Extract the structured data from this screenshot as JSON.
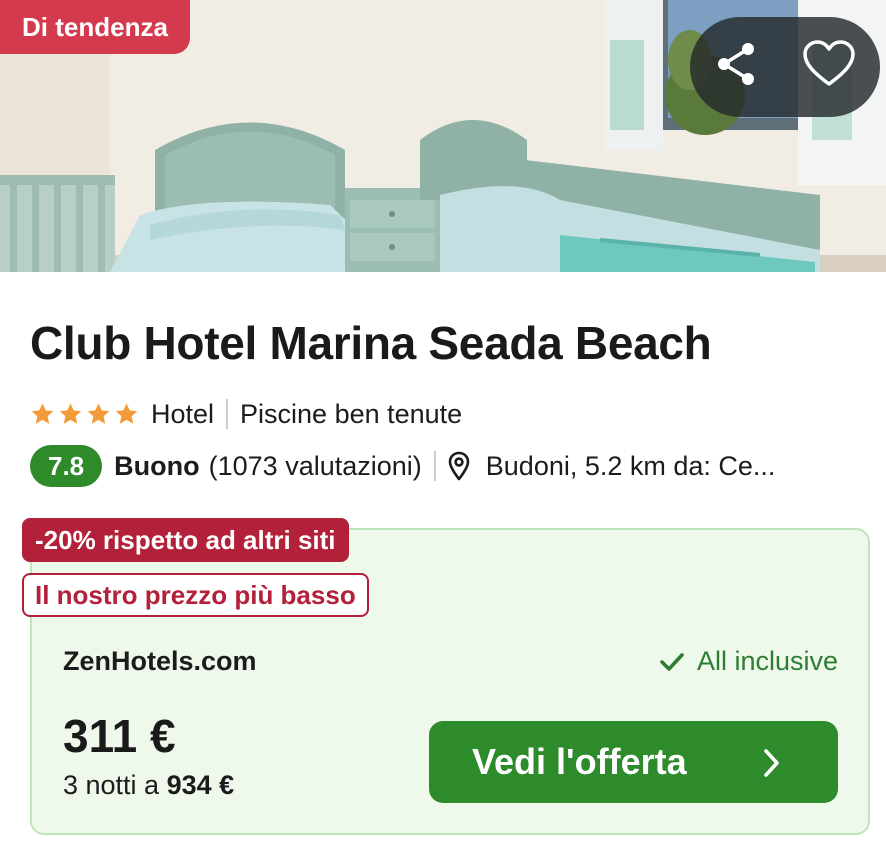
{
  "hero": {
    "badge": "Di tendenza",
    "share_icon": "share-icon",
    "favorite_icon": "heart-icon"
  },
  "hotel": {
    "name": "Club Hotel Marina Seada Beach",
    "stars": 4,
    "type": "Hotel",
    "highlight": "Piscine ben tenute",
    "score": "7.8",
    "rating_word": "Buono",
    "reviews": "(1073 valutazioni)",
    "location": "Budoni, 5.2 km da: Ce..."
  },
  "offer": {
    "discount_tag": "-20% rispetto ad altri siti",
    "lowest_tag": "Il nostro prezzo più basso",
    "provider": "ZenHotels.com",
    "inclusive": "All inclusive",
    "price": "311 €",
    "nights_prefix": "3 notti a",
    "total": "934 €",
    "cta_label": "Vedi l'offerta"
  },
  "colors": {
    "trend_badge": "#d43a4d",
    "score_badge": "#2f8a29",
    "discount": "#b3203a",
    "cta": "#2e8b2b",
    "offer_bg": "#eef9ec",
    "star": "#f29b38"
  }
}
